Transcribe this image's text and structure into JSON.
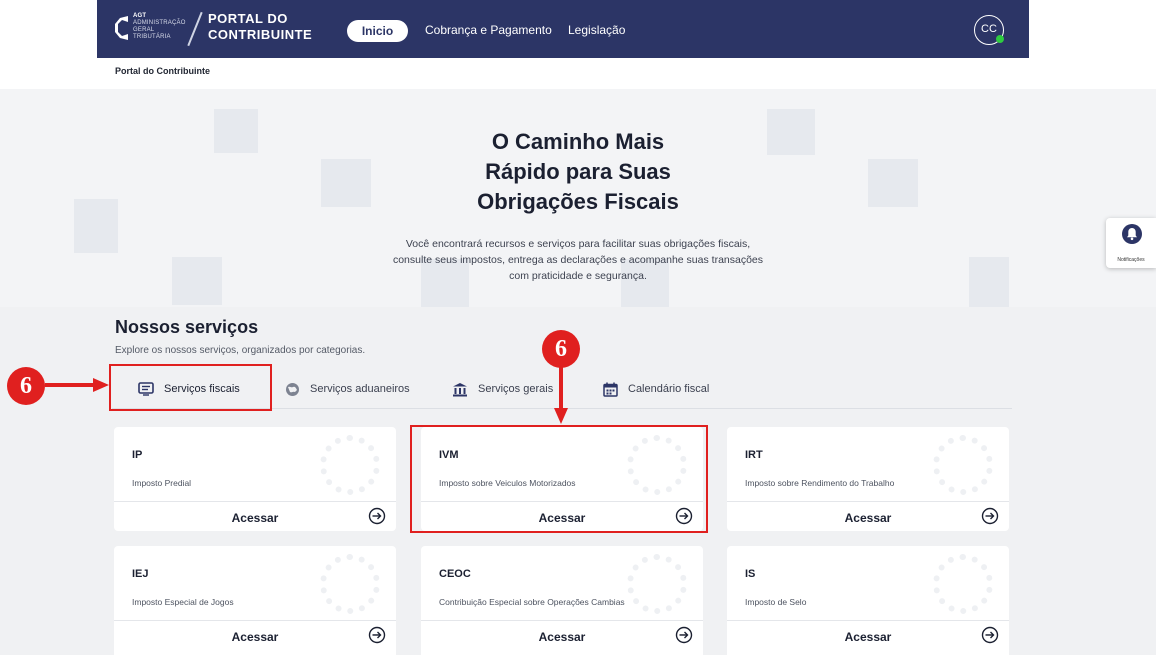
{
  "header": {
    "agt_lines": [
      "AGT",
      "ADMINISTRAÇÃO",
      "GERAL",
      "TRIBUTÁRIA"
    ],
    "portal_line1": "PORTAL DO",
    "portal_line2": "CONTRIBUINTE",
    "nav": {
      "inicio": "Inicio",
      "cobranca": "Cobrança e Pagamento",
      "legislacao": "Legislação"
    },
    "avatar_initials": "CC"
  },
  "breadcrumb": "Portal do Contribuinte",
  "hero": {
    "title_lines": [
      "O Caminho Mais",
      "Rápido para Suas",
      "Obrigações Fiscais"
    ],
    "desc_lines": [
      "Você encontrará recursos e serviços para facilitar suas obrigações fiscais,",
      "consulte seus impostos, entrega as declarações e acompanhe suas transações",
      "com praticidade e segurança."
    ]
  },
  "notifications": {
    "label": "Notificações",
    "icon": "bell-icon"
  },
  "services": {
    "title": "Nossos serviços",
    "subtitle": "Explore os nossos serviços, organizados por categorias.",
    "tabs": [
      {
        "label": "Serviços fiscais",
        "icon": "document-list-icon",
        "active": true
      },
      {
        "label": "Serviços aduaneiros",
        "icon": "globe-icon",
        "active": false
      },
      {
        "label": "Serviços gerais",
        "icon": "bank-icon",
        "active": false
      },
      {
        "label": "Calendário fiscal",
        "icon": "calendar-icon",
        "active": false
      }
    ],
    "cards": [
      {
        "code": "IP",
        "name": "Imposto Predial",
        "action": "Acessar"
      },
      {
        "code": "IVM",
        "name": "Imposto sobre Veiculos Motorizados",
        "action": "Acessar"
      },
      {
        "code": "IRT",
        "name": "Imposto sobre Rendimento do Trabalho",
        "action": "Acessar"
      },
      {
        "code": "IEJ",
        "name": "Imposto Especial de Jogos",
        "action": "Acessar"
      },
      {
        "code": "CEOC",
        "name": "Contribuição Especial sobre Operações Cambias",
        "action": "Acessar"
      },
      {
        "code": "IS",
        "name": "Imposto de Selo",
        "action": "Acessar"
      }
    ]
  },
  "annotations": {
    "step_number": "6",
    "color": "#e0201f"
  },
  "colors": {
    "navbar": "#2c3566",
    "accent": "#e0201f",
    "online": "#2ecc40"
  }
}
